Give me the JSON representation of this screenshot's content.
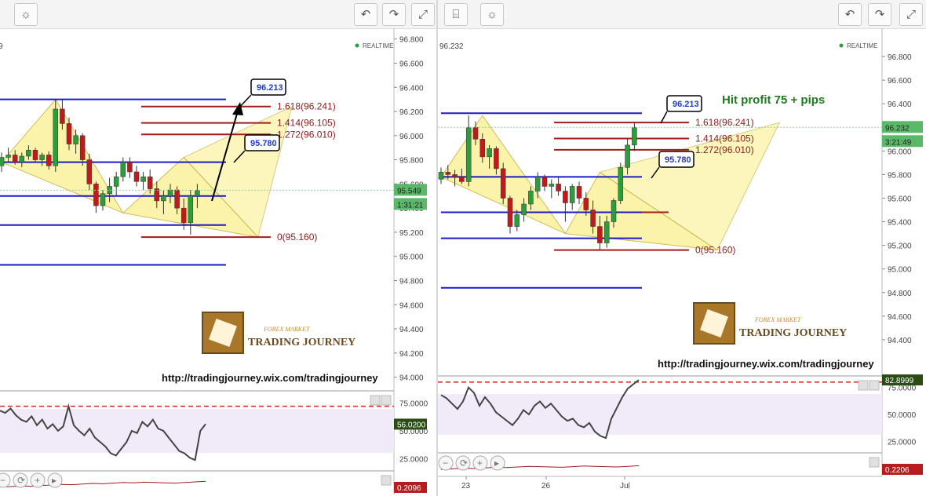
{
  "realtime_label": "REALTIME",
  "url_text": "http://tradingjourney.wix.com/tradingjourney",
  "watermark": {
    "top": "FOREX MARKET",
    "bottom": "TRADING JOURNEY"
  },
  "colors": {
    "bull": "#2e9b3c",
    "bear": "#c21a1a",
    "blue_level": "#1a1acb",
    "fib_level": "#a31b1b",
    "pattern_fill": "#fbf2a0",
    "stoch_bg": "#f1ebf9",
    "price_tag": "#5ab968"
  },
  "toolbar_icons": [
    "bulb-icon",
    "undo-icon",
    "redo-icon",
    "fullscreen-icon",
    "code-icon"
  ],
  "left": {
    "price_tag": "95.549",
    "time_tag": "1:31:21",
    "partial_price": "9",
    "callouts": [
      "96.213",
      "95.780"
    ],
    "stoch_value": "56.0200",
    "macd_value": "0.2096"
  },
  "right": {
    "price_tag": "96.232",
    "time_tag": "3:21:49",
    "price_label": "96.232",
    "callouts": [
      "96.213",
      "95.780"
    ],
    "hit_text": "Hit profit 75 + pips",
    "stoch_value": "82.8999",
    "macd_value": "0.2206",
    "x_labels": [
      "23",
      "26",
      "Jul"
    ]
  },
  "chart_data": [
    {
      "type": "candlestick",
      "panel": "left",
      "ylim": [
        93.9,
        96.85
      ],
      "y_ticks": [
        "96.800",
        "96.600",
        "96.400",
        "96.200",
        "96.000",
        "95.800",
        "95.600",
        "95.400",
        "95.200",
        "95.000",
        "94.800",
        "94.600",
        "94.400",
        "94.200",
        "94.000"
      ],
      "fib_levels": [
        {
          "label": "1.618(96.241)",
          "value": 96.241
        },
        {
          "label": "1.414(96.105)",
          "value": 96.105
        },
        {
          "label": "1.272(96.010)",
          "value": 96.01
        },
        {
          "label": "0(95.160)",
          "value": 95.16
        }
      ],
      "blue_levels": [
        96.3,
        95.78,
        95.5,
        95.26,
        94.93
      ],
      "pattern_points": [
        {
          "x": 0,
          "price": 95.78
        },
        {
          "x": 8,
          "price": 96.3
        },
        {
          "x": 18,
          "price": 95.36
        },
        {
          "x": 27,
          "price": 95.82
        },
        {
          "x": 38,
          "price": 95.16
        },
        {
          "x": 43,
          "price": 96.241
        }
      ],
      "candles": [
        [
          95.75,
          95.86,
          95.7,
          95.82
        ],
        [
          95.82,
          95.9,
          95.78,
          95.84
        ],
        [
          95.84,
          95.88,
          95.76,
          95.78
        ],
        [
          95.78,
          95.86,
          95.74,
          95.83
        ],
        [
          95.83,
          95.92,
          95.8,
          95.88
        ],
        [
          95.88,
          95.9,
          95.78,
          95.8
        ],
        [
          95.8,
          95.86,
          95.75,
          95.84
        ],
        [
          95.84,
          95.87,
          95.72,
          95.75
        ],
        [
          95.75,
          96.3,
          95.7,
          96.22
        ],
        [
          96.22,
          96.3,
          96.05,
          96.1
        ],
        [
          96.1,
          96.15,
          95.88,
          95.93
        ],
        [
          95.93,
          96.05,
          95.85,
          96.0
        ],
        [
          96.0,
          96.02,
          95.75,
          95.8
        ],
        [
          95.8,
          95.85,
          95.55,
          95.6
        ],
        [
          95.6,
          95.62,
          95.36,
          95.42
        ],
        [
          95.42,
          95.55,
          95.38,
          95.52
        ],
        [
          95.52,
          95.65,
          95.45,
          95.58
        ],
        [
          95.58,
          95.7,
          95.5,
          95.66
        ],
        [
          95.66,
          95.82,
          95.62,
          95.78
        ],
        [
          95.78,
          95.82,
          95.65,
          95.7
        ],
        [
          95.7,
          95.75,
          95.58,
          95.62
        ],
        [
          95.62,
          95.7,
          95.55,
          95.66
        ],
        [
          95.66,
          95.72,
          95.52,
          95.56
        ],
        [
          95.56,
          95.62,
          95.4,
          95.46
        ],
        [
          95.46,
          95.55,
          95.35,
          95.5
        ],
        [
          95.5,
          95.6,
          95.44,
          95.55
        ],
        [
          95.55,
          95.58,
          95.35,
          95.4
        ],
        [
          95.4,
          95.48,
          95.22,
          95.28
        ],
        [
          95.28,
          95.55,
          95.18,
          95.5
        ],
        [
          95.5,
          95.6,
          95.4,
          95.548
        ]
      ],
      "stoch": {
        "ylim": [
          20,
          80
        ],
        "level": 72,
        "ticks": [
          "75.0000",
          "50.0000",
          "25.0000"
        ],
        "values": [
          68,
          66,
          70,
          64,
          60,
          58,
          63,
          55,
          60,
          52,
          56,
          50,
          54,
          72,
          55,
          50,
          46,
          52,
          44,
          40,
          36,
          30,
          28,
          34,
          40,
          50,
          48,
          58,
          54,
          60,
          52,
          50,
          44,
          38,
          32,
          30,
          26,
          24,
          50,
          56
        ]
      },
      "macd": {
        "values": [
          0.12,
          0.13,
          0.15,
          0.14,
          0.16,
          0.18,
          0.2,
          0.19,
          0.21,
          0.23,
          0.22,
          0.24,
          0.26,
          0.25,
          0.27,
          0.26,
          0.25,
          0.24,
          0.26,
          0.28,
          0.3
        ]
      }
    },
    {
      "type": "candlestick",
      "panel": "right",
      "ylim": [
        94.1,
        97.0
      ],
      "y_ticks": [
        "96.800",
        "96.600",
        "96.400",
        "96.200",
        "96.000",
        "95.800",
        "95.600",
        "95.400",
        "95.200",
        "95.000",
        "94.800",
        "94.600",
        "94.400"
      ],
      "fib_levels": [
        {
          "label": "1.618(96.241)",
          "value": 96.241
        },
        {
          "label": "1.414(96.105)",
          "value": 96.105
        },
        {
          "label": "1.272(96.010)",
          "value": 96.01
        },
        {
          "label": "0(95.160)",
          "value": 95.16
        }
      ],
      "blue_levels": [
        96.32,
        95.78,
        95.48,
        95.26,
        94.84
      ],
      "red_levels": [
        95.48
      ],
      "pattern_points": [
        {
          "x": 0,
          "price": 95.78
        },
        {
          "x": 6,
          "price": 96.3
        },
        {
          "x": 18,
          "price": 95.3
        },
        {
          "x": 23,
          "price": 95.82
        },
        {
          "x": 40,
          "price": 95.16
        },
        {
          "x": 49,
          "price": 96.24
        }
      ],
      "candles": [
        [
          95.76,
          95.86,
          95.72,
          95.82
        ],
        [
          95.82,
          95.88,
          95.76,
          95.8
        ],
        [
          95.8,
          95.84,
          95.7,
          95.78
        ],
        [
          95.78,
          95.85,
          95.72,
          95.74
        ],
        [
          95.74,
          96.3,
          95.7,
          96.2
        ],
        [
          96.2,
          96.25,
          96.05,
          96.1
        ],
        [
          96.1,
          96.15,
          95.9,
          95.95
        ],
        [
          95.95,
          96.05,
          95.85,
          96.02
        ],
        [
          96.02,
          96.04,
          95.8,
          95.85
        ],
        [
          95.85,
          95.9,
          95.55,
          95.6
        ],
        [
          95.6,
          95.62,
          95.3,
          95.36
        ],
        [
          95.36,
          95.5,
          95.32,
          95.46
        ],
        [
          95.46,
          95.6,
          95.4,
          95.55
        ],
        [
          95.55,
          95.7,
          95.5,
          95.66
        ],
        [
          95.66,
          95.82,
          95.6,
          95.78
        ],
        [
          95.78,
          95.8,
          95.66,
          95.7
        ],
        [
          95.7,
          95.76,
          95.6,
          95.72
        ],
        [
          95.72,
          95.78,
          95.62,
          95.66
        ],
        [
          95.66,
          95.7,
          95.4,
          95.56
        ],
        [
          95.56,
          95.72,
          95.5,
          95.7
        ],
        [
          95.7,
          95.74,
          95.55,
          95.6
        ],
        [
          95.6,
          95.65,
          95.45,
          95.5
        ],
        [
          95.5,
          95.58,
          95.3,
          95.36
        ],
        [
          95.36,
          95.45,
          95.16,
          95.22
        ],
        [
          95.22,
          95.45,
          95.18,
          95.4
        ],
        [
          95.4,
          95.6,
          95.35,
          95.58
        ],
        [
          95.58,
          95.9,
          95.55,
          95.86
        ],
        [
          95.86,
          96.1,
          95.8,
          96.05
        ],
        [
          96.05,
          96.24,
          96.0,
          96.2
        ]
      ],
      "stoch": {
        "ylim": [
          20,
          80
        ],
        "level": 80,
        "ticks": [
          "75.0000",
          "50.0000",
          "25.0000"
        ],
        "values": [
          68,
          65,
          60,
          55,
          62,
          75,
          70,
          58,
          66,
          60,
          52,
          48,
          44,
          40,
          46,
          54,
          50,
          58,
          62,
          56,
          60,
          54,
          48,
          44,
          46,
          40,
          38,
          42,
          34,
          30,
          28,
          46,
          56,
          66,
          74,
          78,
          82
        ]
      },
      "macd": {
        "values": [
          0.1,
          0.12,
          0.14,
          0.13,
          0.15,
          0.17,
          0.16,
          0.18,
          0.2,
          0.19,
          0.18,
          0.17,
          0.19,
          0.21,
          0.2,
          0.19,
          0.18,
          0.2,
          0.22
        ]
      }
    }
  ]
}
